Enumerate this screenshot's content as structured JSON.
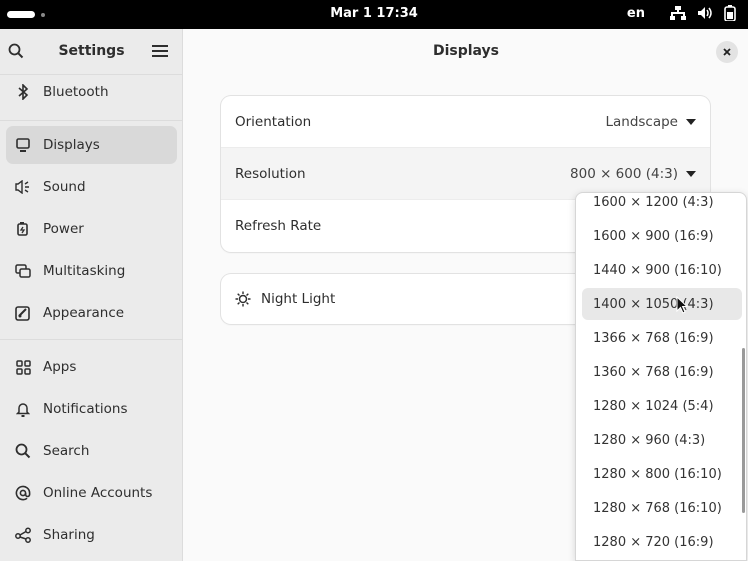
{
  "topbar": {
    "clock": "Mar 1  17:34",
    "language": "en"
  },
  "sidebar": {
    "title": "Settings",
    "items": [
      {
        "label": "Bluetooth",
        "icon": "bluetooth-icon"
      },
      {
        "label": "Displays",
        "icon": "display-icon",
        "active": true
      },
      {
        "label": "Sound",
        "icon": "sound-icon"
      },
      {
        "label": "Power",
        "icon": "power-icon"
      },
      {
        "label": "Multitasking",
        "icon": "multitasking-icon"
      },
      {
        "label": "Appearance",
        "icon": "appearance-icon"
      },
      {
        "label": "Apps",
        "icon": "apps-icon"
      },
      {
        "label": "Notifications",
        "icon": "bell-icon"
      },
      {
        "label": "Search",
        "icon": "search-icon"
      },
      {
        "label": "Online Accounts",
        "icon": "at-icon"
      },
      {
        "label": "Sharing",
        "icon": "share-icon"
      }
    ]
  },
  "main": {
    "title": "Displays",
    "orientation": {
      "label": "Orientation",
      "value": "Landscape"
    },
    "resolution": {
      "label": "Resolution",
      "value": "800 × 600 (4:3)"
    },
    "refresh_rate": {
      "label": "Refresh Rate"
    },
    "night_light": {
      "label": "Night Light"
    }
  },
  "resolution_options": [
    "1600 × 1200 (4:3)",
    "1600 × 900 (16:9)",
    "1440 × 900 (16:10)",
    "1400 × 1050 (4:3)",
    "1366 × 768 (16:9)",
    "1360 × 768 (16:9)",
    "1280 × 1024 (5:4)",
    "1280 × 960 (4:3)",
    "1280 × 800 (16:10)",
    "1280 × 768 (16:10)",
    "1280 × 720 (16:9)"
  ],
  "highlighted_option": "1400 × 1050 (4:3)"
}
